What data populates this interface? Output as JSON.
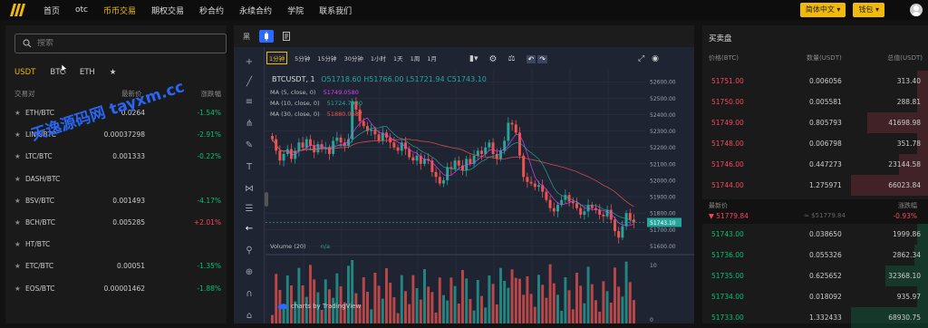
{
  "nav": {
    "items": [
      "首页",
      "otc",
      "币币交易",
      "期权交易",
      "秒合约",
      "永续合约",
      "学院",
      "联系我们"
    ],
    "active_index": 2,
    "language_button": "简体中文 ▾",
    "wallet_button": "钱包 ▾"
  },
  "markets": {
    "search_placeholder": "搜索",
    "tabs": [
      "USDT",
      "BTC",
      "ETH",
      "★"
    ],
    "active_tab": 0,
    "headers": {
      "pair": "交易对",
      "price": "最新价",
      "change": "涨跌幅"
    },
    "rows": [
      {
        "pair": "ETH/BTC",
        "price": "0.0264",
        "change": "-1.54%",
        "dir": "up"
      },
      {
        "pair": "LINK/BTC",
        "price": "0.00037298",
        "change": "-2.91%",
        "dir": "up"
      },
      {
        "pair": "LTC/BTC",
        "price": "0.001333",
        "change": "-0.22%",
        "dir": "up"
      },
      {
        "pair": "DASH/BTC",
        "price": "",
        "change": "",
        "dir": "up"
      },
      {
        "pair": "BSV/BTC",
        "price": "0.001493",
        "change": "-4.17%",
        "dir": "up"
      },
      {
        "pair": "BCH/BTC",
        "price": "0.005285",
        "change": "+2.01%",
        "dir": "down"
      },
      {
        "pair": "HT/BTC",
        "price": "",
        "change": "",
        "dir": "up"
      },
      {
        "pair": "ETC/BTC",
        "price": "0.00051",
        "change": "-1.35%",
        "dir": "up"
      },
      {
        "pair": "EOS/BTC",
        "price": "0.00001462",
        "change": "-1.88%",
        "dir": "up"
      }
    ]
  },
  "chart": {
    "top_tabs": [
      "黑",
      "",
      ""
    ],
    "timeframes": [
      "1分钟",
      "5分钟",
      "15分钟",
      "30分钟",
      "1小时",
      "1天",
      "1周",
      "1月"
    ],
    "active_timeframe": 0,
    "symbol_line": "BTCUSDT, 1",
    "ohlc": "O51718.60  H51766.00  L51721.94  C51743.10",
    "ma5": "MA (5, close, 0)",
    "ma5_val": "51749.0580",
    "ma10": "MA (10, close, 0)",
    "ma10_val": "51724.7930",
    "ma30": "MA (30, close, 0)",
    "ma30_val": "51880.0687",
    "volume_label": "Volume (20)",
    "volume_val": "n/a",
    "attribution": "charts by TradingView",
    "last_price_tag": "51743.10",
    "y_ticks": [
      "52600.00",
      "52500.00",
      "52400.00",
      "52300.00",
      "52200.00",
      "52100.00",
      "52000.00",
      "51900.00",
      "51800.00",
      "51700.00",
      "51600.00"
    ],
    "colors": {
      "up": "#26a69a",
      "down": "#ef5350"
    }
  },
  "chart_data": {
    "type": "candlestick",
    "title": "BTCUSDT, 1",
    "ylim": [
      51580,
      52640
    ],
    "close": [
      52250,
      52180,
      52120,
      52160,
      52190,
      52130,
      52180,
      52230,
      52200,
      52250,
      52210,
      52170,
      52220,
      52190,
      52200,
      52160,
      52240,
      52260,
      52230,
      52210,
      52250,
      52480,
      52430,
      52360,
      52330,
      52300,
      52310,
      52280,
      52240,
      52290,
      52260,
      52230,
      52200,
      52180,
      52230,
      52190,
      52140,
      52120,
      52150,
      52100,
      52130,
      52120,
      52050,
      52020,
      51980,
      52000,
      52080,
      52070,
      52120,
      52090,
      52060,
      52130,
      52100,
      52150,
      52180,
      52160,
      52200,
      52230,
      52160,
      52130,
      52180,
      52240,
      52350,
      52340,
      52290,
      52150,
      52020,
      51990,
      51980,
      51960,
      51970,
      51930,
      51880,
      51830,
      51810,
      51850,
      51880,
      51910,
      51870,
      51860,
      51830,
      51790,
      51810,
      51850,
      51830,
      51820,
      51790,
      51780,
      51820,
      51760,
      51690,
      51650,
      51720,
      51800,
      51760,
      51743
    ]
  },
  "orderbook": {
    "title": "买卖盘",
    "headers": {
      "price": "价格(BTC)",
      "amount": "数量(USDT)",
      "total": "总值(USDT)"
    },
    "asks": [
      {
        "price": "51751.00",
        "amount": "0.006056",
        "total": "313.40",
        "depth": 0.05
      },
      {
        "price": "51750.00",
        "amount": "0.005581",
        "total": "288.81",
        "depth": 0.05
      },
      {
        "price": "51749.00",
        "amount": "0.805793",
        "total": "41698.98",
        "depth": 0.27
      },
      {
        "price": "51748.00",
        "amount": "0.006798",
        "total": "351.78",
        "depth": 0.05
      },
      {
        "price": "51746.00",
        "amount": "0.447273",
        "total": "23144.58",
        "depth": 0.13
      },
      {
        "price": "51744.00",
        "amount": "1.275971",
        "total": "66023.84",
        "depth": 0.34
      }
    ],
    "mid": {
      "label": "最新价",
      "value": "▼ 51779.84",
      "cny": "≈ $51779.84",
      "change_label": "涨跌幅",
      "change": "-0.93%"
    },
    "bids": [
      {
        "price": "51743.00",
        "amount": "0.038650",
        "total": "1999.86",
        "depth": 0.05
      },
      {
        "price": "51736.00",
        "amount": "0.055326",
        "total": "2862.34",
        "depth": 0.06
      },
      {
        "price": "51735.00",
        "amount": "0.625652",
        "total": "32368.10",
        "depth": 0.19
      },
      {
        "price": "51734.00",
        "amount": "0.018092",
        "total": "935.97",
        "depth": 0.05
      },
      {
        "price": "51733.00",
        "amount": "1.332433",
        "total": "68930.75",
        "depth": 0.34
      }
    ]
  },
  "watermark": "天逸源码网 tayxm.cc"
}
